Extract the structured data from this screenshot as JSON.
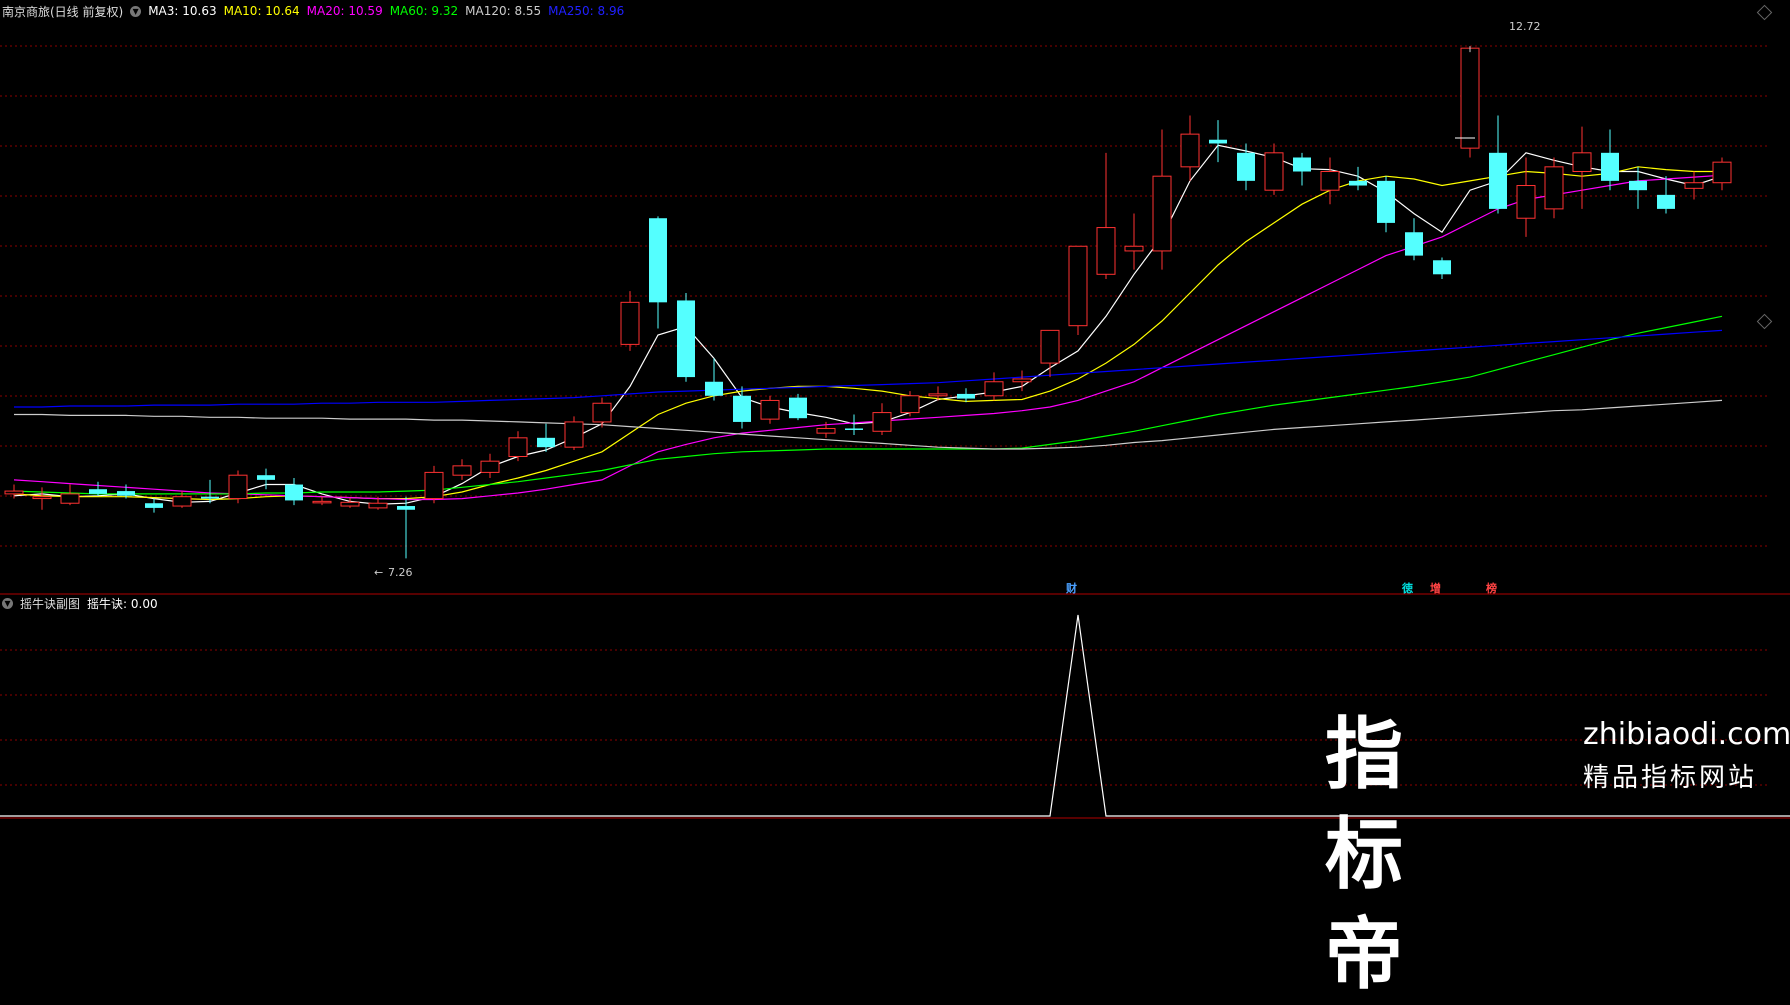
{
  "header": {
    "stock": "南京商旅(日线 前复权)",
    "ma": [
      {
        "label": "MA3: 10.63",
        "color": "#ffffff"
      },
      {
        "label": "MA10: 10.64",
        "color": "#ffff00"
      },
      {
        "label": "MA20: 10.59",
        "color": "#ff00ff"
      },
      {
        "label": "MA60: 9.32",
        "color": "#00ff00"
      },
      {
        "label": "MA120: 8.55",
        "color": "#cccccc"
      },
      {
        "label": "MA250: 8.96",
        "color": "#0000ff"
      }
    ]
  },
  "price_labels": {
    "high": "12.72",
    "low": "7.26"
  },
  "event_tags": [
    {
      "text": "财",
      "color": "#4aa0ff"
    },
    {
      "text": "徳",
      "color": "#00e0e0"
    },
    {
      "text": "增",
      "color": "#ff4444"
    },
    {
      "text": "榜",
      "color": "#ff4444"
    }
  ],
  "sub_header": {
    "title": "摇牛诀副图",
    "indicator": "摇牛诀: 0.00"
  },
  "watermark": {
    "big": "指标帝",
    "url": "zhibiaodi.com",
    "sub": "精品指标网站"
  },
  "colors": {
    "up": "#ff3232",
    "down": "#54ffff",
    "grid": "#8b0000",
    "bg": "#000000"
  },
  "chart_data": {
    "type": "candlestick",
    "ylim": [
      6.9,
      13.0
    ],
    "candles": [
      [
        7.95,
        7.98,
        7.9,
        8.05
      ],
      [
        7.9,
        7.92,
        7.78,
        8.02
      ],
      [
        7.85,
        7.95,
        7.83,
        8.05
      ],
      [
        8.0,
        7.95,
        7.93,
        8.08
      ],
      [
        7.98,
        7.93,
        7.9,
        8.05
      ],
      [
        7.85,
        7.8,
        7.75,
        7.9
      ],
      [
        7.82,
        7.92,
        7.8,
        7.98
      ],
      [
        7.92,
        7.9,
        7.85,
        8.1
      ],
      [
        7.9,
        8.15,
        7.85,
        8.2
      ],
      [
        8.15,
        8.1,
        8.0,
        8.22
      ],
      [
        8.05,
        7.88,
        7.83,
        8.12
      ],
      [
        7.86,
        7.87,
        7.83,
        7.92
      ],
      [
        7.82,
        7.86,
        7.8,
        7.9
      ],
      [
        7.8,
        7.85,
        7.78,
        7.92
      ],
      [
        7.82,
        7.78,
        7.26,
        7.92
      ],
      [
        7.9,
        8.18,
        7.85,
        8.25
      ],
      [
        8.15,
        8.25,
        8.1,
        8.32
      ],
      [
        8.18,
        8.3,
        8.12,
        8.38
      ],
      [
        8.35,
        8.55,
        8.3,
        8.62
      ],
      [
        8.55,
        8.45,
        8.4,
        8.7
      ],
      [
        8.45,
        8.72,
        8.42,
        8.78
      ],
      [
        8.72,
        8.92,
        8.66,
        8.98
      ],
      [
        9.55,
        10.0,
        9.48,
        10.12
      ],
      [
        10.9,
        10.0,
        9.72,
        10.92
      ],
      [
        10.02,
        9.2,
        9.15,
        10.1
      ],
      [
        9.15,
        9.0,
        8.95,
        9.4
      ],
      [
        9.0,
        8.72,
        8.65,
        9.1
      ],
      [
        8.75,
        8.95,
        8.7,
        9.0
      ],
      [
        8.98,
        8.76,
        8.74,
        9.02
      ],
      [
        8.6,
        8.65,
        8.55,
        8.72
      ],
      [
        8.65,
        8.64,
        8.58,
        8.8
      ],
      [
        8.62,
        8.82,
        8.58,
        8.92
      ],
      [
        8.82,
        9.0,
        8.78,
        9.05
      ],
      [
        9.0,
        9.02,
        8.95,
        9.1
      ],
      [
        9.02,
        8.97,
        8.93,
        9.08
      ],
      [
        9.0,
        9.15,
        8.95,
        9.25
      ],
      [
        9.15,
        9.18,
        9.05,
        9.27
      ],
      [
        9.35,
        9.7,
        9.2,
        9.7
      ],
      [
        9.75,
        10.6,
        9.65,
        10.6
      ],
      [
        10.3,
        10.8,
        10.25,
        11.6
      ],
      [
        10.55,
        10.6,
        10.35,
        10.95
      ],
      [
        10.55,
        11.35,
        10.35,
        11.85
      ],
      [
        11.45,
        11.8,
        11.3,
        12.0
      ],
      [
        11.74,
        11.7,
        11.5,
        11.95
      ],
      [
        11.6,
        11.3,
        11.2,
        11.7
      ],
      [
        11.2,
        11.6,
        11.15,
        11.7
      ],
      [
        11.55,
        11.4,
        11.25,
        11.6
      ],
      [
        11.2,
        11.4,
        11.05,
        11.55
      ],
      [
        11.3,
        11.25,
        11.2,
        11.45
      ],
      [
        11.3,
        10.85,
        10.75,
        11.35
      ],
      [
        10.75,
        10.5,
        10.45,
        10.9
      ],
      [
        10.45,
        10.3,
        10.25,
        10.48
      ],
      [
        11.65,
        12.72,
        11.55,
        12.72
      ],
      [
        11.6,
        11.0,
        10.95,
        12.0
      ],
      [
        10.9,
        11.25,
        10.7,
        11.55
      ],
      [
        11.0,
        11.45,
        10.9,
        11.55
      ],
      [
        11.4,
        11.6,
        11.0,
        11.88
      ],
      [
        11.6,
        11.3,
        11.2,
        11.85
      ],
      [
        11.3,
        11.2,
        11.0,
        11.45
      ],
      [
        11.15,
        11.0,
        10.95,
        11.35
      ],
      [
        11.22,
        11.28,
        11.1,
        11.4
      ],
      [
        11.28,
        11.5,
        11.2,
        11.55
      ]
    ],
    "ma_series": [
      {
        "name": "MA3",
        "color": "#ffffff",
        "values": [
          7.93,
          7.95,
          7.92,
          7.93,
          7.95,
          7.9,
          7.86,
          7.87,
          7.96,
          8.05,
          8.05,
          7.95,
          7.87,
          7.84,
          7.85,
          7.92,
          8.06,
          8.24,
          8.35,
          8.42,
          8.55,
          8.7,
          9.1,
          9.65,
          9.74,
          9.4,
          8.98,
          8.88,
          8.82,
          8.77,
          8.7,
          8.72,
          8.82,
          8.96,
          9.0,
          9.04,
          9.1,
          9.3,
          9.48,
          9.85,
          10.3,
          10.7,
          11.3,
          11.68,
          11.62,
          11.55,
          11.43,
          11.42,
          11.35,
          11.18,
          10.95,
          10.75,
          11.2,
          11.3,
          11.6,
          11.52,
          11.45,
          11.4,
          11.4,
          11.32,
          11.25,
          11.35
        ]
      },
      {
        "name": "MA10",
        "color": "#ffff00",
        "values": [
          7.95,
          7.93,
          7.92,
          7.92,
          7.92,
          7.91,
          7.9,
          7.89,
          7.9,
          7.92,
          7.93,
          7.92,
          7.91,
          7.9,
          7.9,
          7.92,
          7.97,
          8.05,
          8.12,
          8.2,
          8.3,
          8.4,
          8.6,
          8.8,
          8.92,
          9.0,
          9.05,
          9.08,
          9.1,
          9.1,
          9.08,
          9.05,
          9.0,
          8.97,
          8.94,
          8.95,
          8.96,
          9.05,
          9.18,
          9.35,
          9.55,
          9.8,
          10.1,
          10.4,
          10.65,
          10.85,
          11.05,
          11.2,
          11.3,
          11.35,
          11.32,
          11.25,
          11.3,
          11.35,
          11.4,
          11.38,
          11.35,
          11.38,
          11.45,
          11.42,
          11.4,
          11.4
        ]
      },
      {
        "name": "MA20",
        "color": "#ff00ff",
        "values": [
          8.1,
          8.08,
          8.06,
          8.04,
          8.02,
          8.0,
          7.98,
          7.96,
          7.95,
          7.94,
          7.93,
          7.92,
          7.91,
          7.9,
          7.89,
          7.89,
          7.9,
          7.93,
          7.96,
          8.0,
          8.05,
          8.1,
          8.25,
          8.4,
          8.48,
          8.55,
          8.6,
          8.63,
          8.66,
          8.69,
          8.71,
          8.73,
          8.75,
          8.77,
          8.79,
          8.81,
          8.84,
          8.88,
          8.95,
          9.05,
          9.15,
          9.3,
          9.45,
          9.6,
          9.75,
          9.9,
          10.05,
          10.2,
          10.35,
          10.5,
          10.6,
          10.7,
          10.85,
          11.0,
          11.1,
          11.15,
          11.2,
          11.25,
          11.3,
          11.32,
          11.34,
          11.36
        ]
      },
      {
        "name": "MA60",
        "color": "#00ff00",
        "values": [
          7.98,
          7.97,
          7.96,
          7.95,
          7.95,
          7.95,
          7.95,
          7.95,
          7.95,
          7.96,
          7.96,
          7.97,
          7.97,
          7.97,
          7.98,
          7.99,
          8.02,
          8.05,
          8.08,
          8.12,
          8.16,
          8.2,
          8.26,
          8.32,
          8.35,
          8.38,
          8.4,
          8.41,
          8.42,
          8.43,
          8.43,
          8.43,
          8.43,
          8.43,
          8.43,
          8.43,
          8.44,
          8.48,
          8.52,
          8.57,
          8.62,
          8.68,
          8.74,
          8.8,
          8.85,
          8.9,
          8.94,
          8.98,
          9.02,
          9.06,
          9.1,
          9.15,
          9.2,
          9.28,
          9.36,
          9.44,
          9.52,
          9.6,
          9.67,
          9.73,
          9.79,
          9.85
        ]
      },
      {
        "name": "MA120",
        "color": "#cccccc",
        "values": [
          8.8,
          8.8,
          8.79,
          8.79,
          8.79,
          8.78,
          8.78,
          8.77,
          8.77,
          8.76,
          8.76,
          8.76,
          8.75,
          8.75,
          8.75,
          8.74,
          8.74,
          8.73,
          8.72,
          8.71,
          8.7,
          8.69,
          8.67,
          8.65,
          8.63,
          8.61,
          8.59,
          8.57,
          8.55,
          8.53,
          8.51,
          8.49,
          8.47,
          8.45,
          8.44,
          8.43,
          8.43,
          8.44,
          8.45,
          8.47,
          8.5,
          8.52,
          8.55,
          8.58,
          8.61,
          8.64,
          8.66,
          8.68,
          8.7,
          8.72,
          8.74,
          8.76,
          8.78,
          8.8,
          8.82,
          8.84,
          8.85,
          8.87,
          8.89,
          8.91,
          8.93,
          8.95
        ]
      },
      {
        "name": "MA250",
        "color": "#0000ff",
        "values": [
          8.88,
          8.88,
          8.89,
          8.89,
          8.89,
          8.9,
          8.9,
          8.9,
          8.91,
          8.91,
          8.91,
          8.92,
          8.92,
          8.93,
          8.93,
          8.93,
          8.94,
          8.95,
          8.96,
          8.97,
          8.98,
          9.0,
          9.02,
          9.04,
          9.05,
          9.06,
          9.07,
          9.08,
          9.09,
          9.1,
          9.11,
          9.12,
          9.13,
          9.14,
          9.16,
          9.18,
          9.2,
          9.22,
          9.24,
          9.26,
          9.28,
          9.3,
          9.32,
          9.34,
          9.36,
          9.38,
          9.4,
          9.42,
          9.44,
          9.46,
          9.48,
          9.5,
          9.52,
          9.54,
          9.56,
          9.58,
          9.6,
          9.62,
          9.64,
          9.66,
          9.68,
          9.7
        ]
      }
    ],
    "indicator": {
      "name": "摇牛诀",
      "peak_index": 38,
      "values_peak": 1.0
    }
  }
}
